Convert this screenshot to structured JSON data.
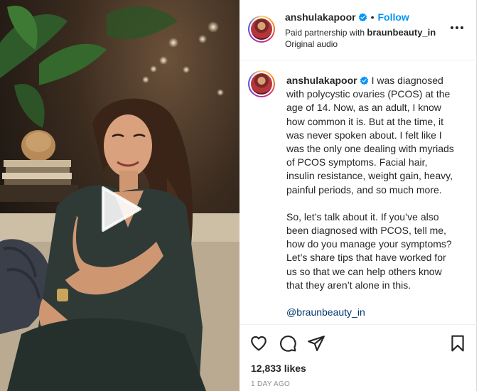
{
  "post": {
    "username": "anshulakapoor",
    "follow_label": "Follow",
    "separator": "•",
    "partnership_prefix": "Paid partnership with",
    "partner": "braunbeauty_in",
    "audio": "Original audio",
    "caption_p1": "I was diagnosed with polycystic ovaries (PCOS) at the age of 14. Now, as an adult, I know how common it is. But at the time, it was never spoken about. I felt like I was the only one dealing with myriads of PCOS symptoms. Facial hair, insulin resistance, weight gain, heavy, painful periods, and so much more.",
    "caption_p2": "So, let’s talk about it. If you’ve also been diagnosed with PCOS, tell me, how do you manage your symptoms? Let’s share tips that have worked for us so that we can help others know that they aren’t alone in this.",
    "mention": "@braunbeauty_in",
    "likes": "12,833 likes",
    "timestamp": "1 DAY AGO"
  },
  "icons": {
    "verified": "verified-badge-icon",
    "more": "more-options-icon",
    "like": "heart-icon",
    "comment": "comment-icon",
    "share": "paper-plane-icon",
    "save": "bookmark-icon",
    "play": "play-icon"
  },
  "colors": {
    "follow": "#0095f6",
    "verified": "#0095f6",
    "mention": "#00376b",
    "muted": "#8e8e8e"
  }
}
